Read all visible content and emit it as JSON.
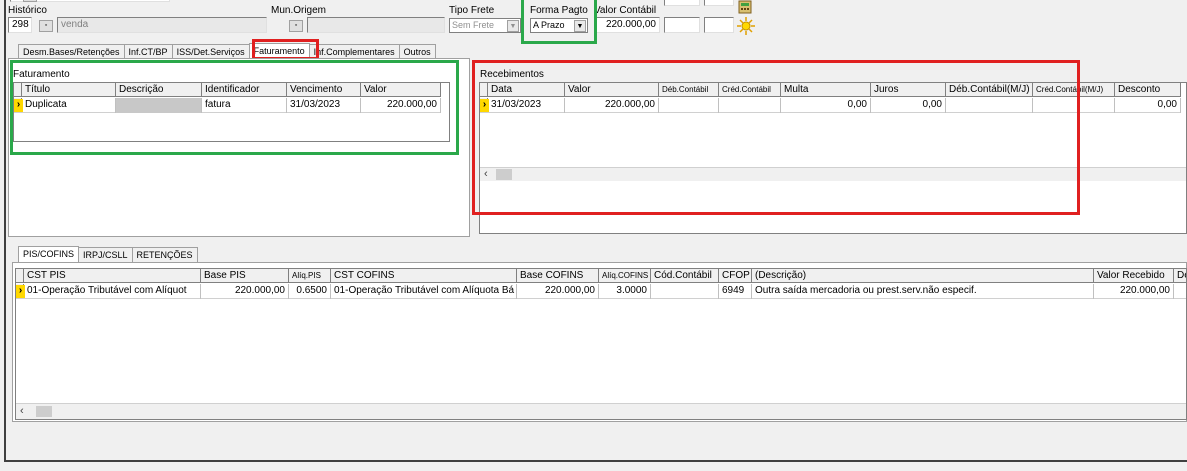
{
  "top": {
    "historico_label": "Histórico",
    "historico_code": "298",
    "historico_desc": "venda",
    "mun_origem_label": "Mun.Origem",
    "tipo_frete_label": "Tipo Frete",
    "tipo_frete_value": "Sem Frete",
    "forma_pagto_label": "Forma Pagto",
    "forma_pagto_value": "A Prazo",
    "valor_contabil_label": "Valor Contábil",
    "valor_contabil_value": "220.000,00"
  },
  "tabs_top": [
    {
      "label": "Desm.Bases/Retenções"
    },
    {
      "label": "Inf.CT/BP"
    },
    {
      "label": "ISS/Det.Serviços"
    },
    {
      "label": "Faturamento"
    },
    {
      "label": "Inf.Complementares"
    },
    {
      "label": "Outros"
    }
  ],
  "faturamento": {
    "title": "Faturamento",
    "headers": [
      "Título",
      "Descrição",
      "Identificador",
      "Vencimento",
      "Valor"
    ],
    "rows": [
      {
        "titulo": "Duplicata",
        "descricao": "",
        "identificador": "fatura",
        "vencimento": "31/03/2023",
        "valor": "220.000,00"
      }
    ]
  },
  "recebimentos": {
    "title": "Recebimentos",
    "headers": [
      "Data",
      "Valor",
      "Déb.Contábil",
      "Créd.Contábil",
      "Multa",
      "Juros",
      "Déb.Contábil(M/J)",
      "Créd.Contábil(M/J)",
      "Desconto"
    ],
    "rows": [
      {
        "data": "31/03/2023",
        "valor": "220.000,00",
        "deb": "",
        "cred": "",
        "multa": "0,00",
        "juros": "0,00",
        "debmj": "",
        "credmj": "",
        "desconto": "0,00"
      }
    ]
  },
  "tabs_bottom": [
    {
      "label": "PIS/COFINS"
    },
    {
      "label": "IRPJ/CSLL"
    },
    {
      "label": "RETENÇÕES"
    }
  ],
  "pis": {
    "headers": [
      "CST PIS",
      "Base PIS",
      "Alíq.PIS",
      "CST COFINS",
      "Base COFINS",
      "Alíq.COFINS",
      "Cód.Contábil",
      "CFOP",
      "(Descrição)",
      "Valor Recebido",
      "De"
    ],
    "rows": [
      {
        "cst_pis": "01-Operação Tributável com Alíquot",
        "base_pis": "220.000,00",
        "aliq_pis": "0.6500",
        "cst_cofins": "01-Operação Tributável com Alíquota Bá",
        "base_cofins": "220.000,00",
        "aliq_cofins": "3.0000",
        "cod": "",
        "cfop": "6949",
        "desc": "Outra saída mercadoria ou prest.serv.não especif.",
        "valor_recebido": "220.000,00",
        "de": ""
      }
    ]
  },
  "colors": {
    "highlight_red": "#e02020",
    "highlight_green": "#2aa84a",
    "indicator": "#ffd800"
  }
}
